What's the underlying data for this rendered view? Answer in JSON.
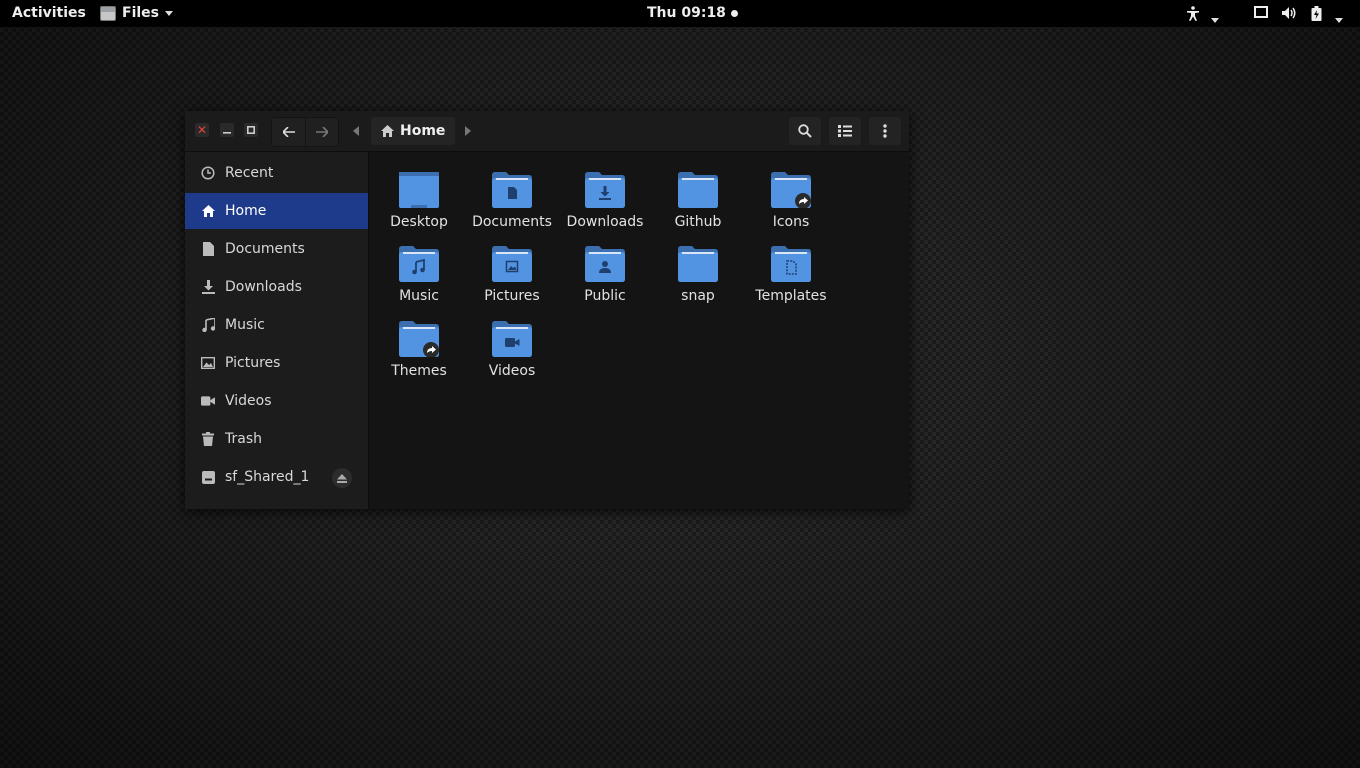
{
  "topbar": {
    "activities": "Activities",
    "app_name": "Files",
    "clock": "Thu 09:18"
  },
  "window": {
    "path": {
      "current": "Home"
    }
  },
  "sidebar": {
    "items": [
      {
        "label": "Recent",
        "icon": "clock-icon"
      },
      {
        "label": "Home",
        "icon": "home-icon",
        "active": true
      },
      {
        "label": "Documents",
        "icon": "document-icon"
      },
      {
        "label": "Downloads",
        "icon": "download-icon"
      },
      {
        "label": "Music",
        "icon": "music-icon"
      },
      {
        "label": "Pictures",
        "icon": "image-icon"
      },
      {
        "label": "Videos",
        "icon": "video-camera-icon"
      },
      {
        "label": "Trash",
        "icon": "trash-icon"
      },
      {
        "label": "sf_Shared_1",
        "icon": "drive-icon",
        "eject": true
      }
    ]
  },
  "files": [
    {
      "label": "Desktop",
      "emblem": "none"
    },
    {
      "label": "Documents",
      "emblem": "document"
    },
    {
      "label": "Downloads",
      "emblem": "download"
    },
    {
      "label": "Github",
      "emblem": "none"
    },
    {
      "label": "Icons",
      "emblem": "symlink"
    },
    {
      "label": "Music",
      "emblem": "music"
    },
    {
      "label": "Pictures",
      "emblem": "image"
    },
    {
      "label": "Public",
      "emblem": "person"
    },
    {
      "label": "snap",
      "emblem": "none"
    },
    {
      "label": "Templates",
      "emblem": "template"
    },
    {
      "label": "Themes",
      "emblem": "symlink"
    },
    {
      "label": "Videos",
      "emblem": "video"
    }
  ],
  "colors": {
    "folder": "#5294e2",
    "folder_dark": "#3b6fb0",
    "active_row": "#1e3a8a",
    "close": "#e0453b"
  }
}
